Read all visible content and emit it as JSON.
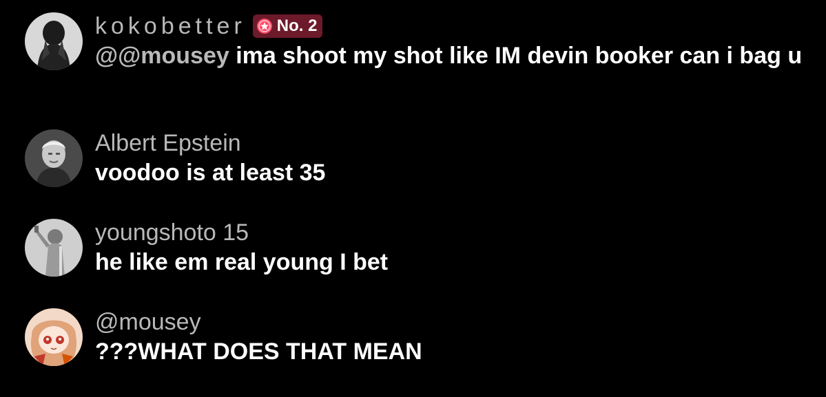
{
  "colors": {
    "background": "#000000",
    "username": "#b9b9b9",
    "comment_text": "#ffffff",
    "badge_bg": "#6d1a2a",
    "badge_icon": "#ff4d6a"
  },
  "comments": [
    {
      "username": "kokobetter",
      "badge": {
        "icon": "medal-icon",
        "label": "No. 2"
      },
      "mention": "@@mousey",
      "text": " ima shoot my shot like IM devin booker can i bag u"
    },
    {
      "username": "Albert Epstein",
      "text": "voodoo is at least 35"
    },
    {
      "username": "youngshoto 15",
      "text": "he like em real young I bet"
    },
    {
      "username": "@mousey",
      "text": "???WHAT DOES THAT MEAN"
    }
  ]
}
